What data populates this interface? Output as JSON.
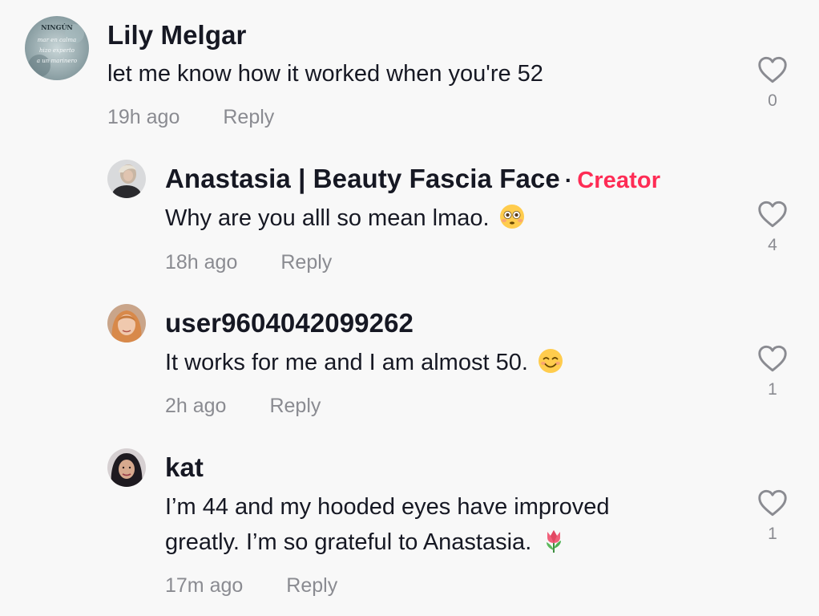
{
  "comments": [
    {
      "username": "Lily Melgar",
      "text": "let me know how it worked when you're 52",
      "time": "19h ago",
      "reply_label": "Reply",
      "likes": "0",
      "avatar_lines": [
        "NINGÚN",
        "mar en calma",
        "hizo experto",
        "a un marinero"
      ]
    },
    {
      "username": "Anastasia | Beauty Fascia Face",
      "badge_sep": "·",
      "badge": "Creator",
      "text": "Why are you alll so mean lmao.",
      "emoji": "flushed-face-emoji",
      "time": "18h ago",
      "reply_label": "Reply",
      "likes": "4"
    },
    {
      "username": "user9604042099262",
      "text": "It works for me and I am almost 50.",
      "emoji": "smiling-face-emoji",
      "time": "2h ago",
      "reply_label": "Reply",
      "likes": "1"
    },
    {
      "username": "kat",
      "text_line1": "I’m 44 and my hooded eyes have improved",
      "text_line2": "greatly. I’m so grateful to Anastasia.",
      "emoji": "tulip-emoji",
      "time": "17m ago",
      "reply_label": "Reply",
      "likes": "1"
    }
  ],
  "colors": {
    "background": "#f8f8f8",
    "text": "#161823",
    "muted": "#8a8b91",
    "creator_badge": "#fe2c55"
  }
}
